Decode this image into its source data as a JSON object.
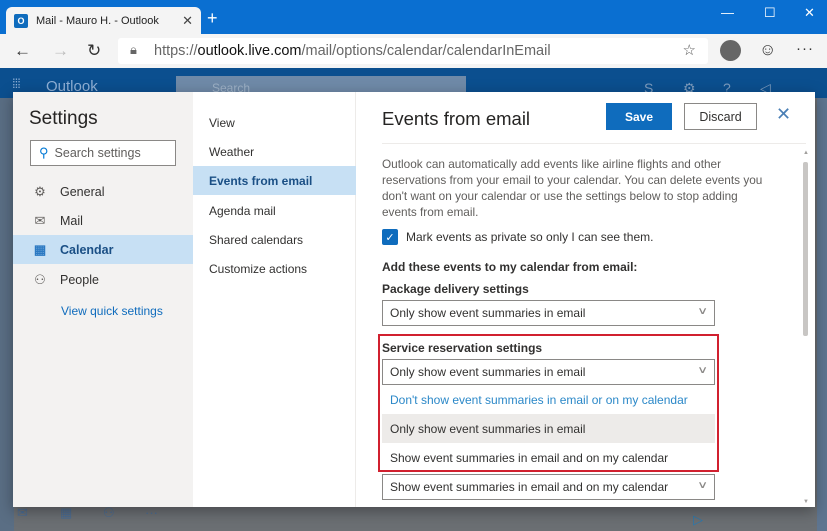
{
  "browser": {
    "tab_title": "Mail - Mauro H. - Outlook",
    "tab_close": "✕",
    "new_tab": "+",
    "url_prefix": "https://",
    "url_host": "outlook.live.com",
    "url_path": "/mail/options/calendar/calendarInEmail",
    "window_controls": {
      "minimize": "—",
      "maximize": "☐",
      "close": "✕"
    }
  },
  "app_header": {
    "brand": "Outlook",
    "search_placeholder": "Search"
  },
  "settings": {
    "title": "Settings",
    "search_placeholder": "Search settings",
    "categories": [
      {
        "label": "General",
        "icon": "gear-icon"
      },
      {
        "label": "Mail",
        "icon": "mail-icon"
      },
      {
        "label": "Calendar",
        "icon": "calendar-icon",
        "active": true
      },
      {
        "label": "People",
        "icon": "people-icon"
      }
    ],
    "quick_settings_link": "View quick settings"
  },
  "calendar_subnav": {
    "items": [
      {
        "label": "View"
      },
      {
        "label": "Weather"
      },
      {
        "label": "Events from email",
        "active": true
      },
      {
        "label": "Agenda mail"
      },
      {
        "label": "Shared calendars"
      },
      {
        "label": "Customize actions"
      }
    ]
  },
  "panel": {
    "title": "Events from email",
    "save_label": "Save",
    "discard_label": "Discard",
    "description": "Outlook can automatically add events like airline flights and other reservations from your email to your calendar. You can delete events you don't want on your calendar or use the settings below to stop adding events from email.",
    "private_checkbox": {
      "label": "Mark events as private so only I can see them.",
      "checked": true
    },
    "section_heading": "Add these events to my calendar from email:",
    "package_delivery": {
      "label": "Package delivery settings",
      "value": "Only show event summaries in email"
    },
    "service_reservation": {
      "label": "Service reservation settings",
      "value": "Only show event summaries in email",
      "options": [
        "Don't show event summaries in email or on my calendar",
        "Only show event summaries in email",
        "Show event summaries in email and on my calendar"
      ],
      "hovered_option_index": 1
    },
    "next_dropdown_value": "Show event summaries in email and on my calendar"
  },
  "colors": {
    "accent": "#0f6cbd",
    "highlight_border": "#d1202f",
    "active_nav_bg": "#c7e0f4"
  }
}
